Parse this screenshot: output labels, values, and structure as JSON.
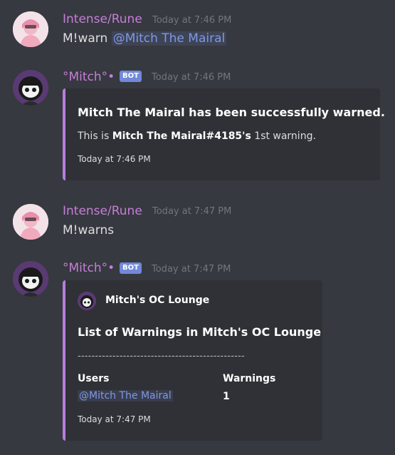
{
  "messages": [
    {
      "author": "Intense/Rune",
      "time": "Today at 7:46 PM",
      "text": "M!warn",
      "mention": "@Mitch The Mairal"
    },
    {
      "author": "°Mitch°•",
      "bot_tag": "BOT",
      "time": "Today at 7:46 PM",
      "embed": {
        "title": "Mitch The Mairal has been successfully warned.",
        "desc_prefix": "This is",
        "desc_bold": "Mitch The Mairal#4185's",
        "desc_suffix": "1st warning.",
        "footer": "Today at 7:46 PM",
        "accent": "#b57edc"
      }
    },
    {
      "author": "Intense/Rune",
      "time": "Today at 7:47 PM",
      "text": "M!warns"
    },
    {
      "author": "°Mitch°•",
      "bot_tag": "BOT",
      "time": "Today at 7:47 PM",
      "embed": {
        "author_name": "Mitch's OC Lounge",
        "title": "List of Warnings in Mitch's OC Lounge",
        "separator": "------------------------------------------------",
        "fields": [
          {
            "name": "Users",
            "value": "@Mitch The Mairal"
          },
          {
            "name": "Warnings",
            "value": "1"
          }
        ],
        "footer": "Today at 7:47 PM",
        "accent": "#b57edc"
      }
    }
  ],
  "colors": {
    "background": "#36393f",
    "embed_bg": "#2f3136",
    "username": "#c77dd9",
    "mention": "#7e98e6",
    "bot_tag": "#7289da"
  }
}
